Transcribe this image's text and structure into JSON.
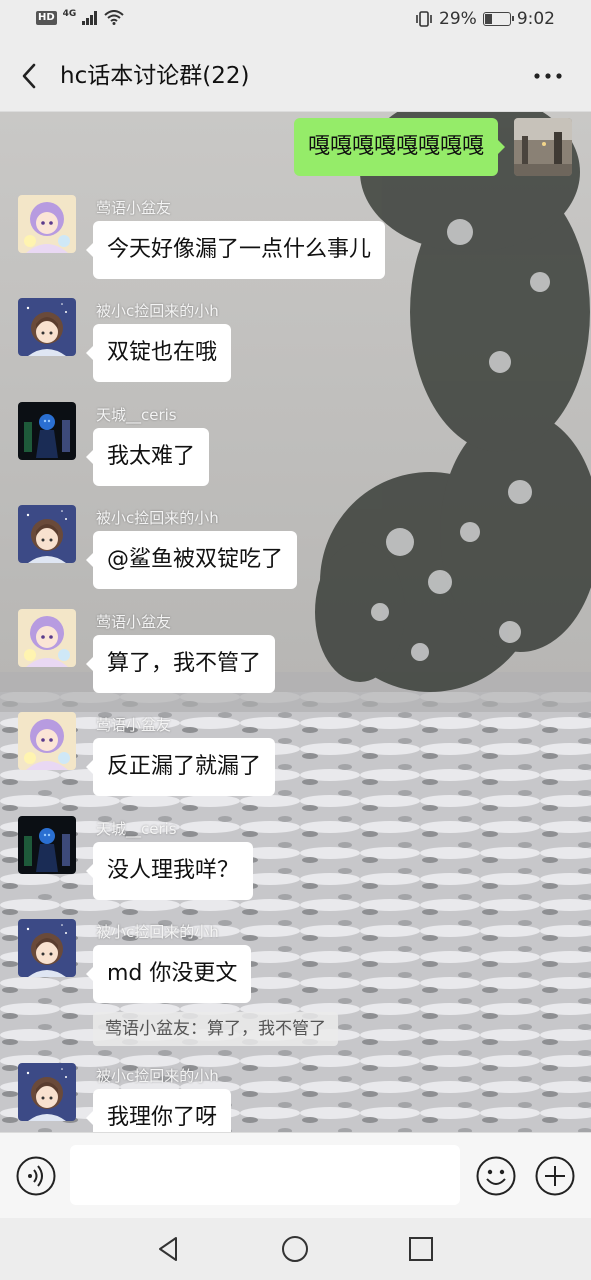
{
  "status_bar": {
    "hd": "HD",
    "network": "4G",
    "battery_percent": "29%",
    "battery_level": 0.29,
    "time": "9:02"
  },
  "header": {
    "title": "hc话本讨论群(22)",
    "back_icon": "back-chevron-icon",
    "more_icon": "more-dots-icon"
  },
  "self_message": {
    "text": "嘎嘎嘎嘎嘎嘎嘎嘎"
  },
  "messages": [
    {
      "sender": "莺语小盆友",
      "text": "今天好像漏了一点什么事儿",
      "avatar": "avatar-anime-girl"
    },
    {
      "sender": "被小c捡回来的小h",
      "text": "双锭也在哦",
      "avatar": "avatar-anime-boy"
    },
    {
      "sender": "天城__ceris",
      "text": "我太难了",
      "avatar": "avatar-dark-figure"
    },
    {
      "sender": "被小c捡回来的小h",
      "text": "@鲨鱼被双锭吃了",
      "avatar": "avatar-anime-boy"
    },
    {
      "sender": "莺语小盆友",
      "text": "算了，我不管了",
      "avatar": "avatar-anime-girl"
    },
    {
      "sender": "莺语小盆友",
      "text": "反正漏了就漏了",
      "avatar": "avatar-anime-girl"
    },
    {
      "sender": "天城__ceris",
      "text": "没人理我咩？",
      "avatar": "avatar-dark-figure"
    },
    {
      "sender": "被小c捡回来的小h",
      "text": "md 你没更文",
      "avatar": "avatar-anime-boy"
    },
    {
      "sender": "被小c捡回来的小h",
      "text": "我理你了呀",
      "avatar": "avatar-anime-boy"
    }
  ],
  "quote": {
    "text": "莺语小盆友：算了，我不管了"
  },
  "input_bar": {
    "input_value": "",
    "voice_icon": "voice-icon",
    "emoji_icon": "emoji-icon",
    "plus_icon": "plus-icon"
  },
  "nav_bar": {
    "back_icon": "nav-back-icon",
    "home_icon": "nav-home-icon",
    "recent_icon": "nav-recent-icon"
  }
}
